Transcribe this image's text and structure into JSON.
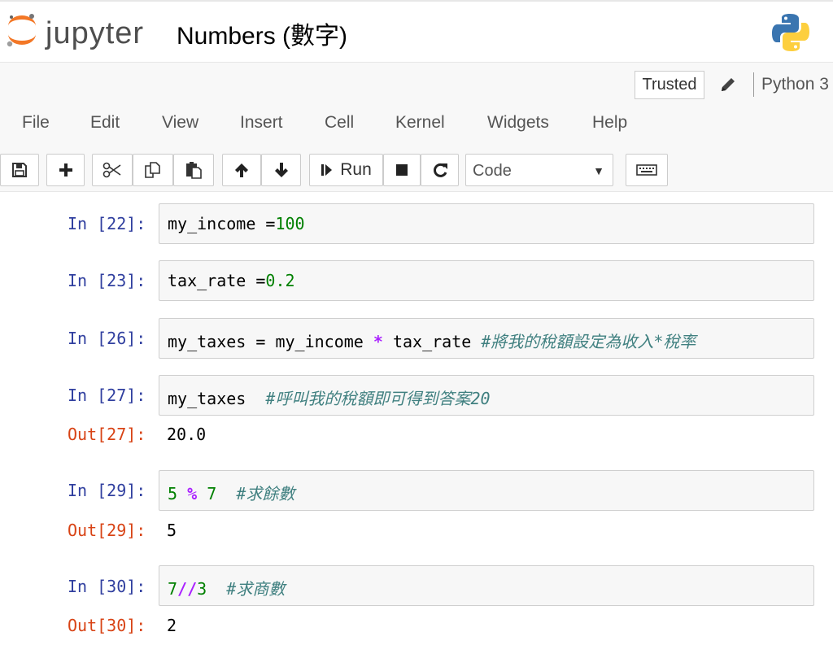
{
  "header": {
    "logo_text": "jupyter",
    "notebook_title": "Numbers (數字)"
  },
  "status": {
    "trusted_label": "Trusted",
    "kernel_name": "Python 3"
  },
  "menu": [
    "File",
    "Edit",
    "View",
    "Insert",
    "Cell",
    "Kernel",
    "Widgets",
    "Help"
  ],
  "toolbar": {
    "run_label": "Run",
    "cell_type": "Code",
    "icons": [
      "save-icon",
      "plus-icon",
      "cut-icon",
      "copy-icon",
      "paste-icon",
      "arrow-up-icon",
      "arrow-down-icon",
      "run-icon",
      "stop-icon",
      "restart-icon",
      "keyboard-icon"
    ]
  },
  "cells": [
    {
      "prompt": "In [22]:",
      "code": [
        {
          "t": "my_income =",
          "c": ""
        },
        {
          "t": "100",
          "c": "num"
        }
      ]
    },
    {
      "prompt": "In [23]:",
      "code": [
        {
          "t": "tax_rate =",
          "c": ""
        },
        {
          "t": "0.2",
          "c": "num"
        }
      ]
    },
    {
      "prompt": "In [26]:",
      "code": [
        {
          "t": "my_taxes = my_income ",
          "c": ""
        },
        {
          "t": "*",
          "c": "op"
        },
        {
          "t": " tax_rate ",
          "c": ""
        },
        {
          "t": "#將我的稅額設定為收入*稅率",
          "c": "cm"
        }
      ]
    },
    {
      "prompt": "In [27]:",
      "code": [
        {
          "t": "my_taxes  ",
          "c": ""
        },
        {
          "t": "#呼叫我的稅額即可得到答案20",
          "c": "cm"
        }
      ],
      "out_prompt": "Out[27]:",
      "output": "20.0"
    },
    {
      "prompt": "In [29]:",
      "code": [
        {
          "t": "5",
          "c": "num"
        },
        {
          "t": " ",
          "c": ""
        },
        {
          "t": "%",
          "c": "op"
        },
        {
          "t": " ",
          "c": ""
        },
        {
          "t": "7",
          "c": "num"
        },
        {
          "t": "  ",
          "c": ""
        },
        {
          "t": "#求餘數",
          "c": "cm"
        }
      ],
      "out_prompt": "Out[29]:",
      "output": "5"
    },
    {
      "prompt": "In [30]:",
      "code": [
        {
          "t": "7",
          "c": "num"
        },
        {
          "t": "//",
          "c": "op"
        },
        {
          "t": "3",
          "c": "num"
        },
        {
          "t": "  ",
          "c": ""
        },
        {
          "t": "#求商數",
          "c": "cm"
        }
      ],
      "out_prompt": "Out[30]:",
      "output": "2"
    }
  ]
}
